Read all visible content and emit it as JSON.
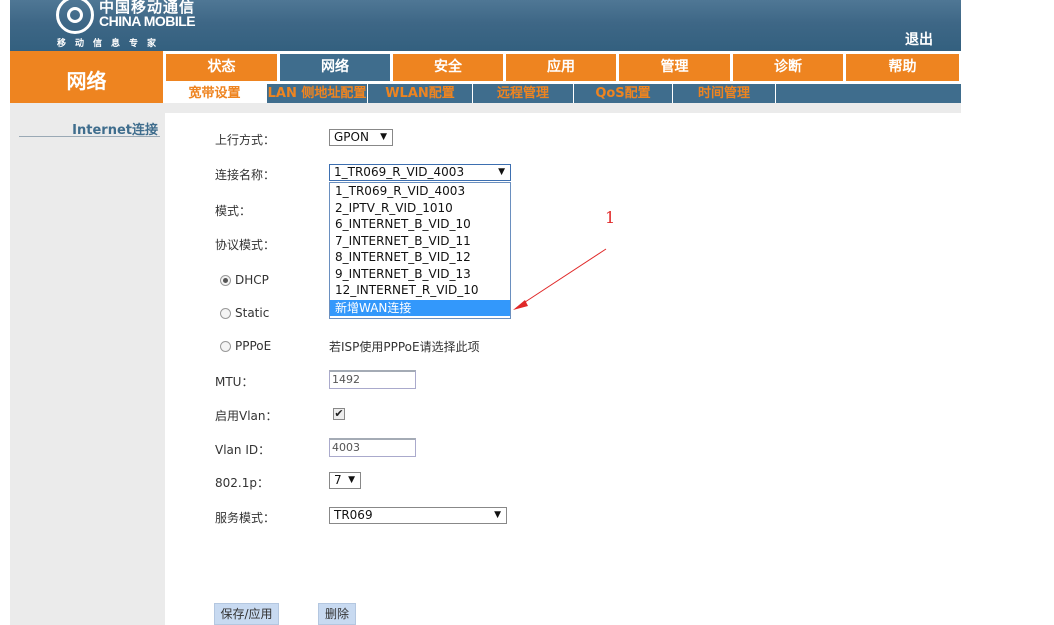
{
  "header": {
    "logo_cn": "中国移动通信",
    "logo_en": "CHINA MOBILE",
    "logo_slogan": "移动信息专家",
    "logout_label": "退出"
  },
  "section_title": "网络",
  "top_menu": [
    "状态",
    "网络",
    "安全",
    "应用",
    "管理",
    "诊断",
    "帮助"
  ],
  "top_menu_active": "网络",
  "sub_menu": [
    "宽带设置",
    "LAN 侧地址配置",
    "WLAN配置",
    "远程管理",
    "QoS配置",
    "时间管理"
  ],
  "sub_menu_active": "宽带设置",
  "sidebar": {
    "items": [
      "Internet连接"
    ]
  },
  "form": {
    "uplink_label": "上行方式：",
    "uplink_value": "GPON",
    "conn_name_label": "连接名称：",
    "conn_name_value": "1_TR069_R_VID_4003",
    "mode_label": "模式：",
    "protocol_label": "协议模式：",
    "radio_dhcp": "DHCP",
    "radio_static": "Static",
    "radio_pppoe": "PPPoE",
    "pppoe_hint": "若ISP使用PPPoE请选择此项",
    "mtu_label": "MTU：",
    "mtu_value": "1492",
    "vlan_enable_label": "启用Vlan：",
    "vlan_enabled": true,
    "vlan_id_label": "Vlan ID：",
    "vlan_id_value": "4003",
    "priority_label": "802.1p：",
    "priority_value": "7",
    "service_mode_label": "服务模式：",
    "service_mode_value": "TR069"
  },
  "dropdown": {
    "options": [
      "1_TR069_R_VID_4003",
      "2_IPTV_R_VID_1010",
      "6_INTERNET_B_VID_10",
      "7_INTERNET_B_VID_11",
      "8_INTERNET_B_VID_12",
      "9_INTERNET_B_VID_13",
      "12_INTERNET_R_VID_10",
      "新增WAN连接"
    ],
    "highlighted": "新增WAN连接"
  },
  "buttons": {
    "save_apply": "保存/应用",
    "delete": "删除"
  },
  "annotation": {
    "number": "1",
    "color": "#e02828"
  },
  "colors": {
    "orange": "#ee8420",
    "steel_blue": "#3f6d8d",
    "header_blue": "#3e6786",
    "highlight": "#3398fb"
  }
}
